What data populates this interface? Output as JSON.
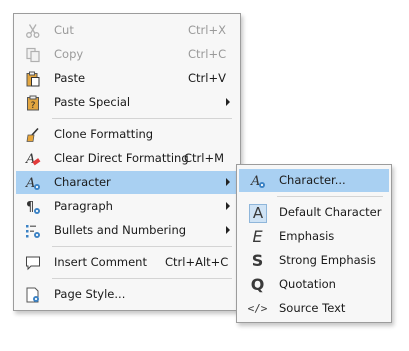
{
  "main_menu": {
    "items": [
      {
        "label": "Cut",
        "shortcut": "Ctrl+X",
        "icon": "scissors-icon",
        "disabled": true
      },
      {
        "label": "Copy",
        "shortcut": "Ctrl+C",
        "icon": "copy-icon",
        "disabled": true
      },
      {
        "label": "Paste",
        "shortcut": "Ctrl+V",
        "icon": "paste-icon",
        "disabled": false
      },
      {
        "label": "Paste Special",
        "icon": "paste-special-icon",
        "submenu": true
      },
      {
        "label": "Clone Formatting",
        "icon": "clone-formatting-brush-icon"
      },
      {
        "label": "Clear Direct Formatting",
        "shortcut": "Ctrl+M",
        "icon": "clear-formatting-icon"
      },
      {
        "label": "Character",
        "icon": "character-icon",
        "submenu": true,
        "highlighted": true
      },
      {
        "label": "Paragraph",
        "icon": "paragraph-icon",
        "submenu": true
      },
      {
        "label": "Bullets and Numbering",
        "icon": "bullets-numbering-icon",
        "submenu": true
      },
      {
        "label": "Insert Comment",
        "shortcut": "Ctrl+Alt+C",
        "icon": "comment-icon"
      },
      {
        "label": "Page Style...",
        "icon": "page-style-icon"
      }
    ]
  },
  "sub_menu": {
    "items": [
      {
        "label": "Character...",
        "icon": "character-dialog-icon",
        "highlighted": true
      },
      {
        "label": "Default Character",
        "icon": "default-character-icon",
        "glyph": "A"
      },
      {
        "label": "Emphasis",
        "icon": "emphasis-icon",
        "glyph": "E"
      },
      {
        "label": "Strong Emphasis",
        "icon": "strong-emphasis-icon",
        "glyph": "S"
      },
      {
        "label": "Quotation",
        "icon": "quotation-icon",
        "glyph": "Q"
      },
      {
        "label": "Source Text",
        "icon": "source-text-icon",
        "glyph": "</>"
      }
    ]
  },
  "colors": {
    "highlight": "#a9d0f2",
    "menu_bg": "#f7f7f7",
    "disabled_text": "#9a9a9a"
  }
}
